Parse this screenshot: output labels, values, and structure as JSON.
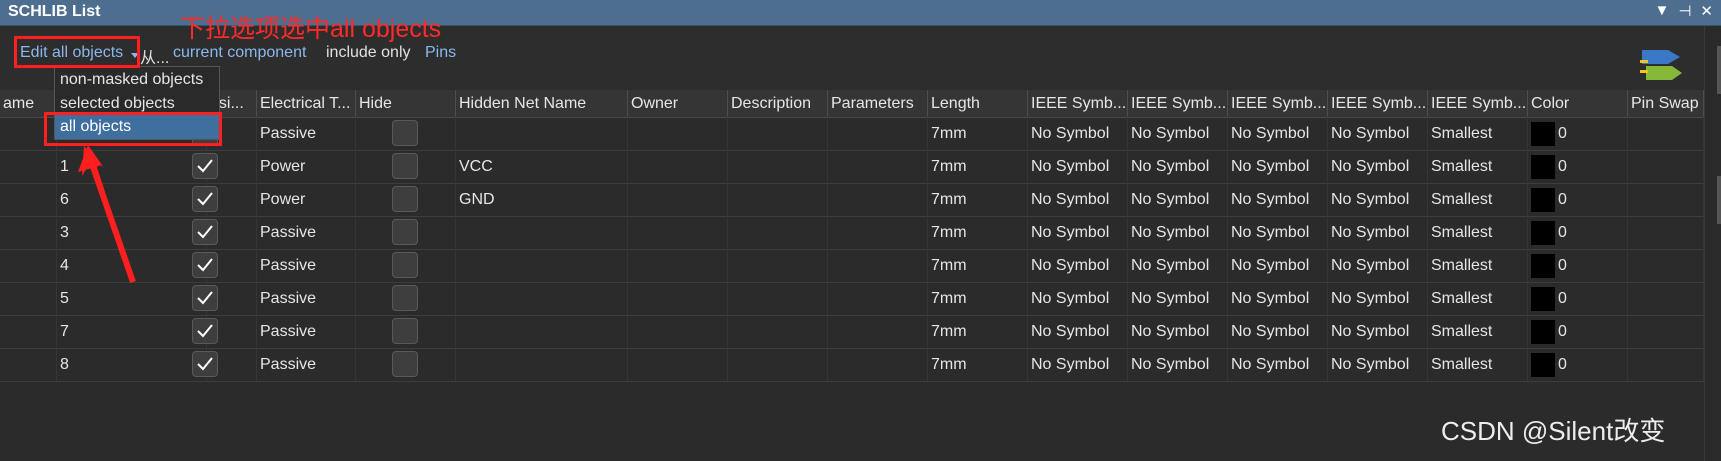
{
  "window": {
    "title": "SCHLIB List",
    "controls": [
      "▼",
      "⊣",
      "✕"
    ]
  },
  "annotation": {
    "text": "下拉选项选中all objects",
    "color": "#ff2a2a"
  },
  "toolbar": {
    "edit_mode": "Edit all objects",
    "from_prefix": "从...",
    "scope": "current component",
    "include_only": "include only",
    "object_kind": "Pins"
  },
  "dropdown": {
    "options": [
      "non-masked objects",
      "selected objects",
      "all objects"
    ],
    "selected": "all objects"
  },
  "grid": {
    "columns": [
      "ame",
      "",
      "esi...",
      "Electrical T...",
      "Hide",
      "Hidden Net Name",
      "Owner",
      "Description",
      "Parameters",
      "Length",
      "IEEE Symb...",
      "IEEE Symb...",
      "IEEE Symb...",
      "IEEE Symb...",
      "IEEE Symb...",
      "Color",
      "Pin Swap"
    ],
    "rows": [
      {
        "name": "",
        "desig": true,
        "etype": "Passive",
        "hide": false,
        "net": "",
        "length": "7mm",
        "ieee": [
          "No Symbol",
          "No Symbol",
          "No Symbol",
          "No Symbol",
          "Smallest"
        ],
        "color": "0"
      },
      {
        "name": "1",
        "desig": true,
        "etype": "Power",
        "hide": false,
        "net": "VCC",
        "length": "7mm",
        "ieee": [
          "No Symbol",
          "No Symbol",
          "No Symbol",
          "No Symbol",
          "Smallest"
        ],
        "color": "0"
      },
      {
        "name": "6",
        "desig": true,
        "etype": "Power",
        "hide": false,
        "net": "GND",
        "length": "7mm",
        "ieee": [
          "No Symbol",
          "No Symbol",
          "No Symbol",
          "No Symbol",
          "Smallest"
        ],
        "color": "0"
      },
      {
        "name": "3",
        "desig": true,
        "etype": "Passive",
        "hide": false,
        "net": "",
        "length": "7mm",
        "ieee": [
          "No Symbol",
          "No Symbol",
          "No Symbol",
          "No Symbol",
          "Smallest"
        ],
        "color": "0"
      },
      {
        "name": "4",
        "desig": true,
        "etype": "Passive",
        "hide": false,
        "net": "",
        "length": "7mm",
        "ieee": [
          "No Symbol",
          "No Symbol",
          "No Symbol",
          "No Symbol",
          "Smallest"
        ],
        "color": "0"
      },
      {
        "name": "5",
        "desig": true,
        "etype": "Passive",
        "hide": false,
        "net": "",
        "length": "7mm",
        "ieee": [
          "No Symbol",
          "No Symbol",
          "No Symbol",
          "No Symbol",
          "Smallest"
        ],
        "color": "0"
      },
      {
        "name": "7",
        "desig": true,
        "etype": "Passive",
        "hide": false,
        "net": "",
        "length": "7mm",
        "ieee": [
          "No Symbol",
          "No Symbol",
          "No Symbol",
          "No Symbol",
          "Smallest"
        ],
        "color": "0"
      },
      {
        "name": "8",
        "desig": true,
        "etype": "Passive",
        "hide": false,
        "net": "",
        "length": "7mm",
        "ieee": [
          "No Symbol",
          "No Symbol",
          "No Symbol",
          "No Symbol",
          "Smallest"
        ],
        "color": "0"
      }
    ]
  },
  "watermark": "CSDN @Silent改变",
  "colors": {
    "title_bar": "#4d6e8f",
    "link_blue": "#8ab8ee",
    "highlight_red": "#ff1f1f",
    "selection": "#3f6f9f"
  }
}
